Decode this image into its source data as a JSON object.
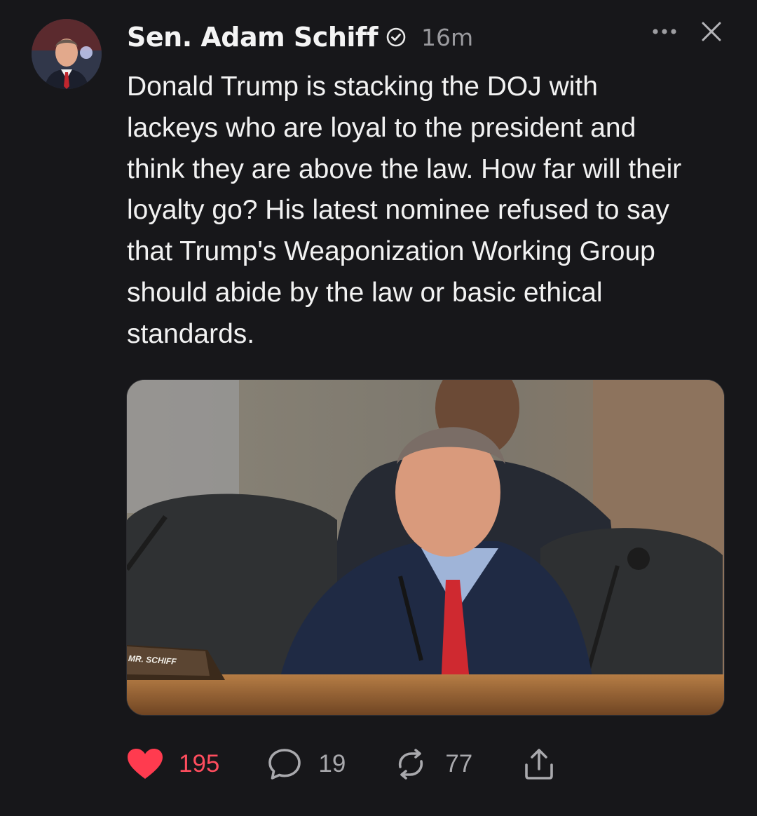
{
  "post": {
    "author": "Sen. Adam Schiff",
    "timestamp": "16m",
    "text": "Donald Trump is stacking the DOJ with\nlackeys who are loyal to the president and\nthink they are above the law. How far will their\nloyalty go? His latest nominee refused to say\nthat Trump's Weaponization Working Group\nshould abide by the law or basic ethical\nstandards.",
    "media": {
      "nameplate": "MR. SCHIFF"
    }
  },
  "actions": {
    "likes": "195",
    "replies": "19",
    "reposts": "77"
  },
  "colors": {
    "background": "#17171a",
    "like": "#ff3b4f",
    "muted": "#a9a9ad"
  },
  "icons": {
    "verified": "verified-icon",
    "more": "more-icon",
    "close": "close-icon",
    "like": "heart-icon",
    "reply": "comment-icon",
    "repost": "repost-icon",
    "share": "share-icon"
  }
}
